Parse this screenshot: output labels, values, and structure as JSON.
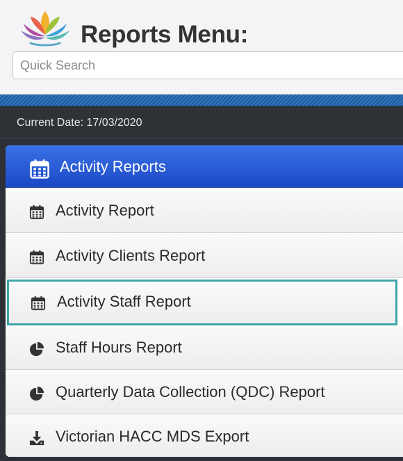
{
  "header": {
    "title": "Reports Menu:",
    "logo_icon": "lotus-logo-icon"
  },
  "search": {
    "placeholder": "Quick Search"
  },
  "status": {
    "current_date": "Current Date: 17/03/2020"
  },
  "menu": {
    "section_title": "Activity Reports",
    "section_icon": "calendar-icon",
    "items": [
      {
        "label": "Activity Report",
        "icon": "calendar-icon"
      },
      {
        "label": "Activity Clients Report",
        "icon": "calendar-icon"
      },
      {
        "label": "Activity Staff Report",
        "icon": "calendar-icon",
        "selected": true
      },
      {
        "label": "Staff Hours Report",
        "icon": "pie-chart-icon"
      },
      {
        "label": "Quarterly Data Collection (QDC) Report",
        "icon": "pie-chart-icon"
      },
      {
        "label": "Victorian HACC MDS Export",
        "icon": "download-icon"
      }
    ]
  },
  "colors": {
    "accent_blue": "#2a5bd7",
    "selected_border": "#3fa5a8",
    "stripe_blue": "#2a6aad",
    "dark_bar": "#2f3237"
  }
}
